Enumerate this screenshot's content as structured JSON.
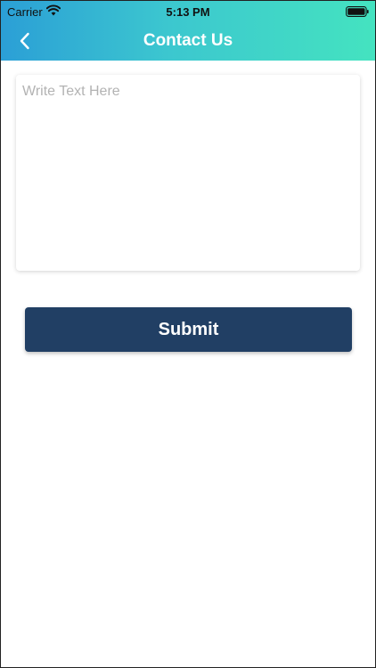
{
  "status_bar": {
    "carrier": "Carrier",
    "time": "5:13 PM",
    "wifi_icon": "wifi-icon",
    "battery_icon": "battery-icon"
  },
  "nav": {
    "title": "Contact Us",
    "back_icon": "chevron-left-icon"
  },
  "form": {
    "message_placeholder": "Write Text Here",
    "message_value": "",
    "submit_label": "Submit"
  },
  "colors": {
    "header_gradient_start": "#2b9fd6",
    "header_gradient_end": "#44e3c0",
    "submit_background": "#213f64",
    "placeholder_text": "#b3b3b3"
  }
}
